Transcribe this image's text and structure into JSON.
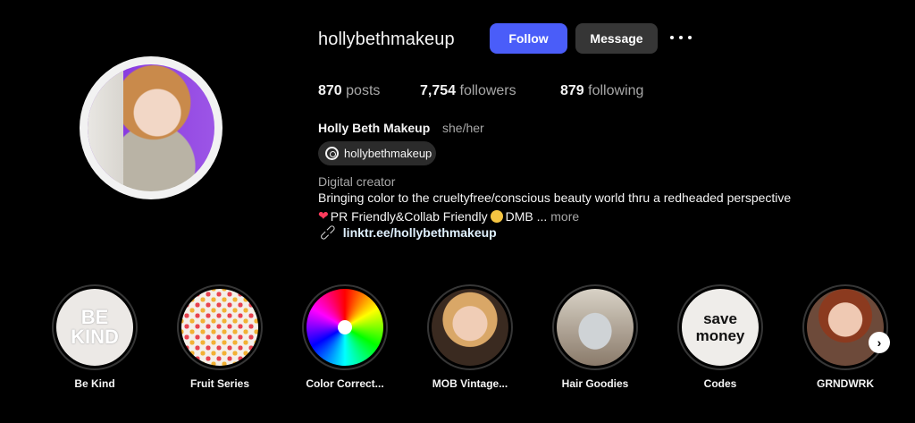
{
  "profile": {
    "username": "hollybethmakeup",
    "follow_label": "Follow",
    "message_label": "Message",
    "more_options_icon": "more-horizontal-icon",
    "stats": {
      "posts_count": "870",
      "posts_label": "posts",
      "followers_count": "7,754",
      "followers_label": "followers",
      "following_count": "879",
      "following_label": "following"
    },
    "full_name": "Holly Beth Makeup",
    "pronouns": "she/her",
    "threads_handle": "hollybethmakeup",
    "category": "Digital creator",
    "bio_line1": "Bringing color to the crueltyfree/conscious beauty world thru a redheaded perspective",
    "bio_line2_heart": "❤",
    "bio_line2_a": "PR Friendly&Collab Friendly",
    "bio_line2_b": "DMB ...",
    "bio_more": "more",
    "link": "linktr.ee/hollybethmakeup"
  },
  "highlights": [
    {
      "label": "Be Kind",
      "cover_text": "BE\nKIND"
    },
    {
      "label": "Fruit Series"
    },
    {
      "label": "Color Correct..."
    },
    {
      "label": "MOB Vintage..."
    },
    {
      "label": "Hair Goodies"
    },
    {
      "label": "Codes",
      "cover_text": "save\nmoney"
    },
    {
      "label": "GRNDWRK"
    }
  ],
  "colors": {
    "follow_button": "#4a5df9",
    "message_button": "#363636",
    "background": "#000000",
    "secondary_text": "#a8a8a8"
  }
}
